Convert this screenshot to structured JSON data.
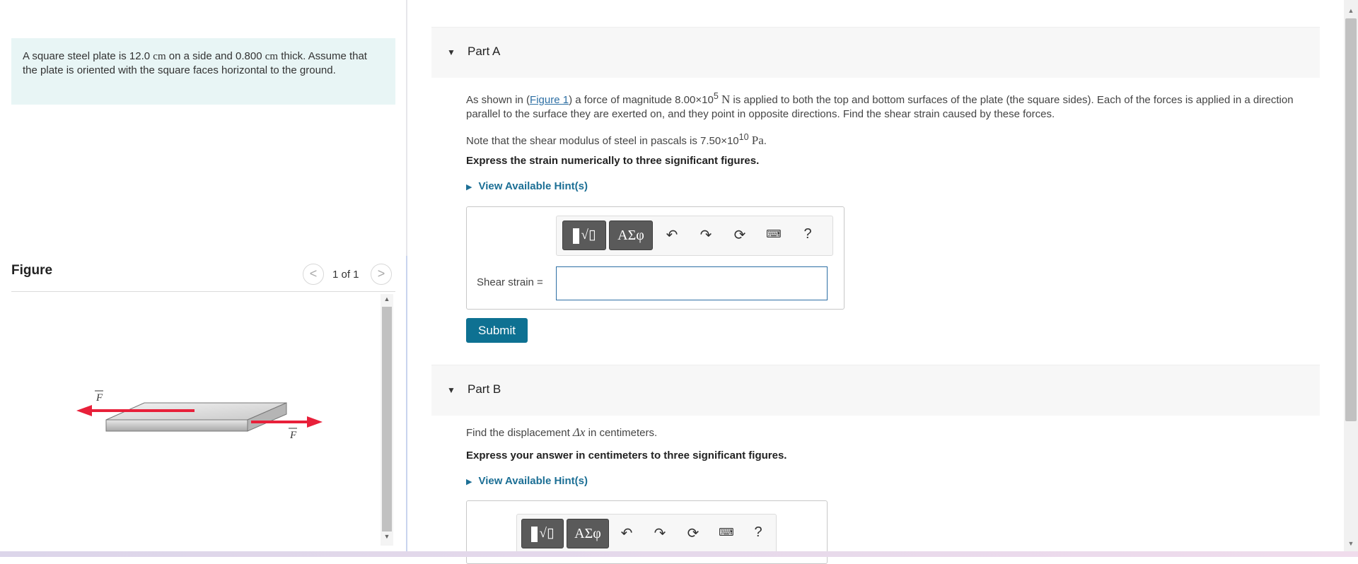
{
  "intro": {
    "t1": "A square steel plate is 12.0 ",
    "u1": "cm",
    "t2": " on a side and 0.800 ",
    "u2": "cm",
    "t3": " thick. Assume that the plate is oriented with the square faces horizontal to the ground."
  },
  "figure": {
    "title": "Figure",
    "pager": "1 of 1",
    "prev": "<",
    "next": ">",
    "force_label": "F"
  },
  "partA": {
    "label": "Part A",
    "p1_a": "As shown in (",
    "p1_link": "Figure 1",
    "p1_b": ") a force of magnitude 8.00×10",
    "p1_exp": "5",
    "p1_unit": "N",
    "p1_c": " is applied to both the top and bottom surfaces of the plate (the square sides). Each of the forces is applied in a direction parallel to the surface they are exerted on, and they point in opposite directions. Find the shear strain caused by these forces.",
    "p2_a": "Note that the shear modulus of steel in pascals is 7.50×10",
    "p2_exp": "10",
    "p2_unit": "Pa",
    "p2_end": ".",
    "instruction": "Express the strain numerically to three significant figures.",
    "hint": "View Available Hint(s)",
    "answer_label": "Shear strain =",
    "answer_value": "",
    "submit": "Submit"
  },
  "partB": {
    "label": "Part B",
    "p1_a": "Find the displacement ",
    "p1_sym": "Δx",
    "p1_b": " in centimeters.",
    "instruction": "Express your answer in centimeters to three significant figures.",
    "hint": "View Available Hint(s)"
  },
  "toolbar": {
    "templates": "√▯",
    "greek": "ΑΣφ",
    "undo_icon": "undo-icon",
    "redo_icon": "redo-icon",
    "reset_icon": "reset-icon",
    "keyboard_icon": "keyboard-icon",
    "help": "?"
  },
  "colors": {
    "intro_bg": "#e8f5f5",
    "submit_bg": "#0e7192",
    "link": "#2d6fa4",
    "hint": "#1c6f95",
    "force_arrow": "#e8203a"
  }
}
